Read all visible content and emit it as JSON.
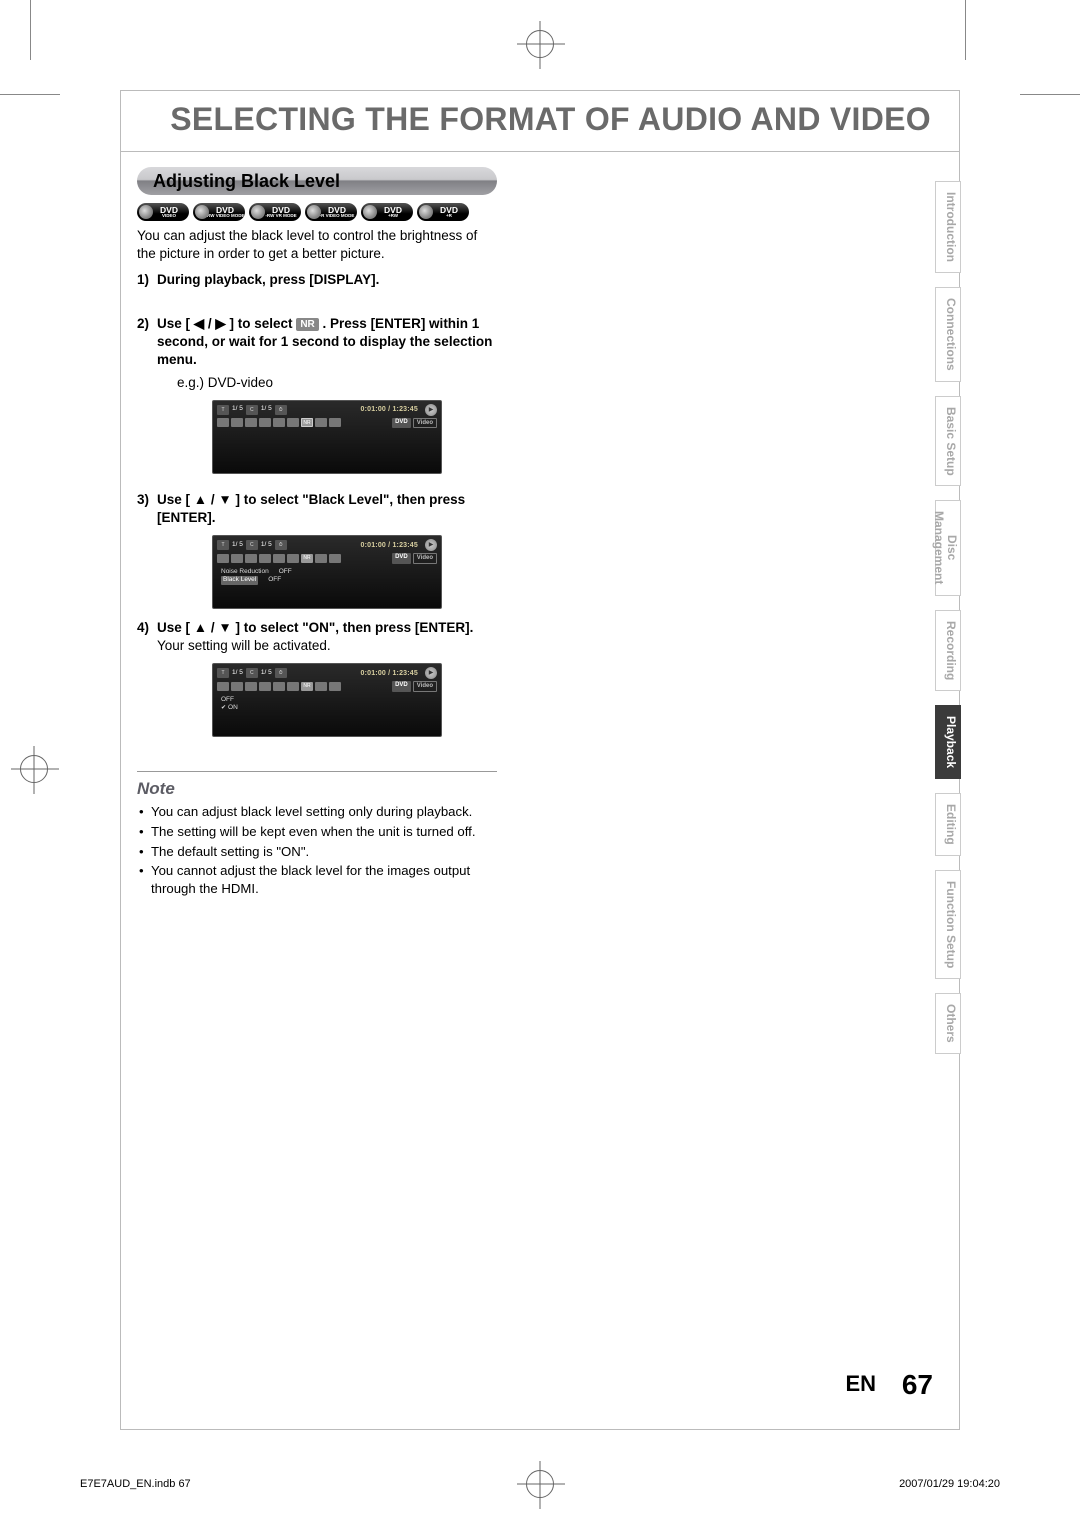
{
  "page_title": "SELECTING THE FORMAT OF AUDIO AND VIDEO",
  "section_header": "Adjusting Black Level",
  "disc_badges": [
    {
      "main": "DVD",
      "sub": "VIDEO"
    },
    {
      "main": "DVD",
      "sub": "-RW VIDEO MODE"
    },
    {
      "main": "DVD",
      "sub": "-RW VR MODE"
    },
    {
      "main": "DVD",
      "sub": "-R VIDEO MODE"
    },
    {
      "main": "DVD",
      "sub": "+RW"
    },
    {
      "main": "DVD",
      "sub": "+R"
    }
  ],
  "intro": "You can adjust the black level to control the brightness of the picture in order to get a better picture.",
  "step1": {
    "num": "1)",
    "text": "During playback, press [DISPLAY]."
  },
  "step2": {
    "num": "2)",
    "pre": "Use [ ◀ / ▶ ] to select ",
    "nr": "NR",
    "post": ". Press [ENTER] within 1 second, or wait for 1 second to display the selection menu.",
    "eg": "e.g.) DVD-video"
  },
  "step3": {
    "num": "3)",
    "text": "Use [ ▲ / ▼ ] to select \"Black Level\", then press [ENTER]."
  },
  "step4": {
    "num": "4)",
    "bold": "Use [ ▲ / ▼ ] to select \"ON\", then press [ENTER].",
    "plain": "Your setting will be activated."
  },
  "osd": {
    "title_pos": "1/  5",
    "chapter_pos": "1/  5",
    "time": "0:01:00 / 1:23:45",
    "tag1": "DVD",
    "tag2": "Video",
    "nr_label": "NR",
    "list_screen3": [
      {
        "label": "Noise Reduction",
        "value": "OFF",
        "hl": false
      },
      {
        "label": "Black Level",
        "value": "OFF",
        "hl": true
      }
    ],
    "list_screen4": [
      {
        "label": "OFF",
        "chk": false
      },
      {
        "label": "ON",
        "chk": true
      }
    ]
  },
  "note_title": "Note",
  "notes": [
    "You can adjust black level setting only during playback.",
    "The setting will be kept even when the unit is turned off.",
    "The default setting is \"ON\".",
    "You cannot adjust the black level for the images output through the HDMI."
  ],
  "tabs": [
    {
      "label": "Introduction",
      "active": false
    },
    {
      "label": "Connections",
      "active": false
    },
    {
      "label": "Basic Setup",
      "active": false
    },
    {
      "label": "Disc\nManagement",
      "active": false,
      "double": true
    },
    {
      "label": "Recording",
      "active": false
    },
    {
      "label": "Playback",
      "active": true
    },
    {
      "label": "Editing",
      "active": false
    },
    {
      "label": "Function Setup",
      "active": false
    },
    {
      "label": "Others",
      "active": false
    }
  ],
  "footer": {
    "en": "EN",
    "page": "67",
    "meta_left": "E7E7AUD_EN.indb   67",
    "meta_right": "2007/01/29   19:04:20"
  }
}
